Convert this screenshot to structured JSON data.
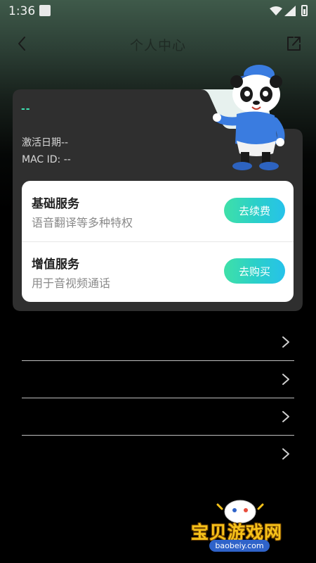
{
  "status_bar": {
    "time": "1:36"
  },
  "nav": {
    "title": "个人中心"
  },
  "card": {
    "device_name": "--",
    "activation_date": "激活日期--",
    "mac_id": "MAC ID: --"
  },
  "services": [
    {
      "name": "基础服务",
      "desc": "语音翻译等多种特权",
      "button": "去续费"
    },
    {
      "name": "增值服务",
      "desc": "用于音视频通话",
      "button": "去购买"
    }
  ],
  "menu": {
    "items": [
      {
        "label": ""
      },
      {
        "label": ""
      },
      {
        "label": ""
      },
      {
        "label": ""
      }
    ]
  },
  "watermark": {
    "text": "宝贝游戏网",
    "url": "baobeiy.com"
  },
  "colors": {
    "accent_start": "#3fe0a8",
    "accent_end": "#26c2ea",
    "card_bg": "#2f2f2f"
  },
  "icons": [
    "back-icon",
    "share-icon",
    "chevron-right-icon",
    "wifi-icon",
    "signal-icon",
    "battery-icon",
    "mascot-panda"
  ]
}
